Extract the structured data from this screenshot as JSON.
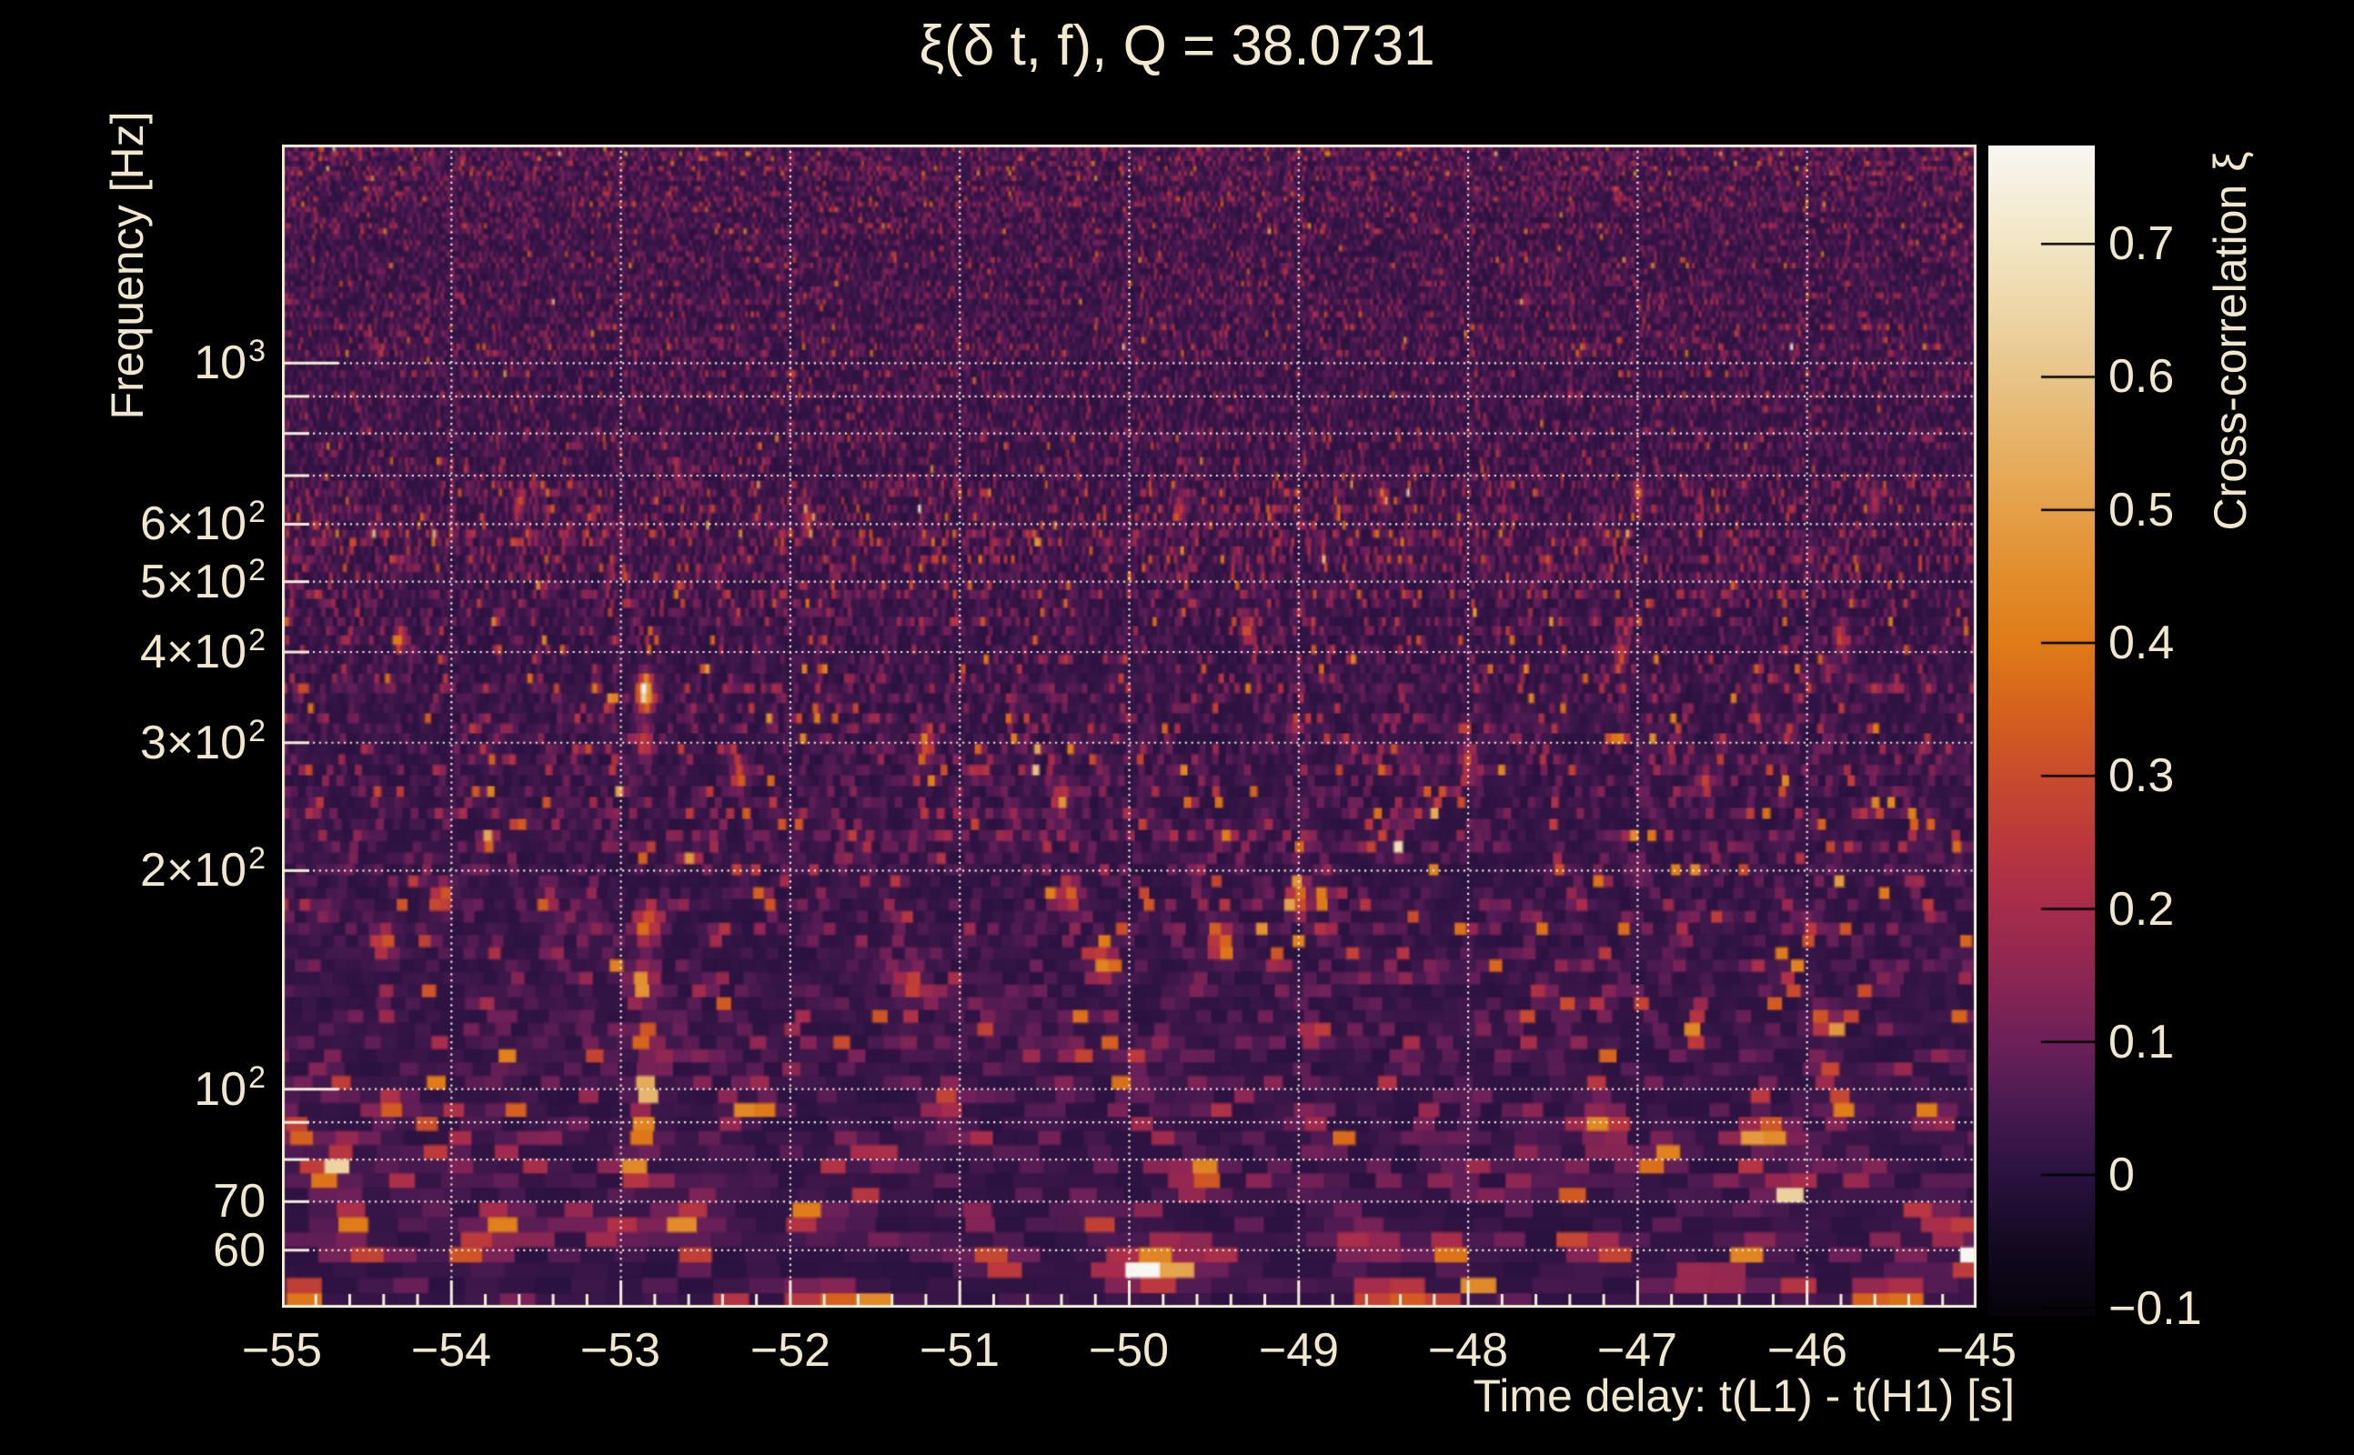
{
  "chart_data": {
    "type": "heatmap",
    "title": "ξ(δ t, f), Q = 38.0731",
    "q_value": 38.0731,
    "xlabel": "Time delay: t(L1) - t(H1) [s]",
    "ylabel": "Frequency [Hz]",
    "colorbar_label": "Cross-correlation ξ",
    "x_range_s": [
      -55,
      -45
    ],
    "y_range_hz": [
      50,
      2000
    ],
    "y_scale": "log",
    "z_range": [
      -0.106,
      0.774
    ],
    "grid": "dotted, every 1 s vertical; 60-1000 Hz decades horizontal",
    "x_ticks": [
      {
        "t": -55,
        "label": "−55"
      },
      {
        "t": -54,
        "label": "−54"
      },
      {
        "t": -53,
        "label": "−53"
      },
      {
        "t": -52,
        "label": "−52"
      },
      {
        "t": -51,
        "label": "−51"
      },
      {
        "t": -50,
        "label": "−50"
      },
      {
        "t": -49,
        "label": "−49"
      },
      {
        "t": -48,
        "label": "−48"
      },
      {
        "t": -47,
        "label": "−47"
      },
      {
        "t": -46,
        "label": "−46"
      },
      {
        "t": -45,
        "label": "−45"
      }
    ],
    "x_minor_tick_step_s": 0.2,
    "y_ticks": [
      {
        "f": 1000,
        "base": "10",
        "sup": "3"
      },
      {
        "f": 600,
        "base": "6×10",
        "sup": "2"
      },
      {
        "f": 500,
        "base": "5×10",
        "sup": "2"
      },
      {
        "f": 400,
        "base": "4×10",
        "sup": "2"
      },
      {
        "f": 300,
        "base": "3×10",
        "sup": "2"
      },
      {
        "f": 200,
        "base": "2×10",
        "sup": "2"
      },
      {
        "f": 100,
        "base": "10",
        "sup": "2"
      },
      {
        "f": 70,
        "base": "70"
      },
      {
        "f": 60,
        "base": "60"
      }
    ],
    "grid_frequencies": [
      60,
      70,
      80,
      90,
      100,
      200,
      300,
      400,
      500,
      600,
      700,
      800,
      900,
      1000
    ],
    "y_major_tick_frequencies": [
      100,
      1000
    ],
    "y_minor_tick_frequencies": [
      60,
      70,
      80,
      90,
      200,
      300,
      400,
      500,
      600,
      700,
      800,
      900,
      2000
    ],
    "colorbar_ticks": [
      {
        "v": 0.7,
        "label": "0.7"
      },
      {
        "v": 0.6,
        "label": "0.6"
      },
      {
        "v": 0.5,
        "label": "0.5"
      },
      {
        "v": 0.4,
        "label": "0.4"
      },
      {
        "v": 0.3,
        "label": "0.3"
      },
      {
        "v": 0.2,
        "label": "0.2"
      },
      {
        "v": 0.1,
        "label": "0.1"
      },
      {
        "v": 0.0,
        "label": "0"
      },
      {
        "v": -0.1,
        "label": "−0.1"
      }
    ],
    "colormap": [
      {
        "v": -0.106,
        "c": "#060309"
      },
      {
        "v": -0.05,
        "c": "#140a22"
      },
      {
        "v": 0.0,
        "c": "#2a1240"
      },
      {
        "v": 0.05,
        "c": "#481a50"
      },
      {
        "v": 0.1,
        "c": "#6d2059"
      },
      {
        "v": 0.15,
        "c": "#8c2653"
      },
      {
        "v": 0.2,
        "c": "#a62c4c"
      },
      {
        "v": 0.25,
        "c": "#ba383e"
      },
      {
        "v": 0.3,
        "c": "#c94b2c"
      },
      {
        "v": 0.35,
        "c": "#d6621e"
      },
      {
        "v": 0.4,
        "c": "#df7c18"
      },
      {
        "v": 0.45,
        "c": "#e28d2c"
      },
      {
        "v": 0.5,
        "c": "#e5a048"
      },
      {
        "v": 0.55,
        "c": "#e7b266"
      },
      {
        "v": 0.6,
        "c": "#e9c489"
      },
      {
        "v": 0.65,
        "c": "#eed6a7"
      },
      {
        "v": 0.7,
        "c": "#f2e6c4"
      },
      {
        "v": 0.774,
        "c": "#f8f7f2"
      }
    ],
    "noise_bands": [
      {
        "f_lo": 50,
        "f_hi": 65,
        "v": 0.035,
        "sp": 0.05,
        "sa": 0.3
      },
      {
        "f_lo": 65,
        "f_hi": 100,
        "v": 0.038,
        "sp": 0.04,
        "sa": 0.26
      },
      {
        "f_lo": 100,
        "f_hi": 200,
        "v": 0.04,
        "sp": 0.03,
        "sa": 0.26
      },
      {
        "f_lo": 200,
        "f_hi": 450,
        "v": 0.048,
        "sp": 0.025,
        "sa": 0.27
      },
      {
        "f_lo": 450,
        "f_hi": 750,
        "v": 0.058,
        "sp": 0.018,
        "sa": 0.22
      },
      {
        "f_lo": 750,
        "f_hi": 1000,
        "v": 0.046,
        "sp": 0.006,
        "sa": 0.14
      },
      {
        "f_lo": 1000,
        "f_hi": 1500,
        "v": 0.052,
        "sp": 0.004,
        "sa": 0.1
      },
      {
        "f_lo": 1500,
        "f_hi": 2001,
        "v": 0.06,
        "sp": 0.004,
        "sa": 0.1
      }
    ],
    "hotspots": [
      [
        -52.86,
        352,
        0.7,
        0.03,
        0.016
      ],
      [
        -52.86,
        300,
        0.28,
        0.03,
        0.014
      ],
      [
        -52.85,
        168,
        0.4,
        0.045,
        0.016
      ],
      [
        -52.87,
        140,
        0.5,
        0.045,
        0.016
      ],
      [
        -52.86,
        118,
        0.44,
        0.04,
        0.015
      ],
      [
        -52.85,
        100,
        0.6,
        0.045,
        0.015
      ],
      [
        -52.88,
        88,
        0.46,
        0.05,
        0.014
      ],
      [
        -52.92,
        78,
        0.38,
        0.055,
        0.014
      ],
      [
        -52.62,
        66,
        0.48,
        0.085,
        0.014
      ],
      [
        -53.05,
        64,
        0.33,
        0.085,
        0.013
      ],
      [
        -53.7,
        66,
        0.42,
        0.085,
        0.014
      ],
      [
        -53.85,
        60,
        0.4,
        0.08,
        0.013
      ],
      [
        -54.73,
        77,
        0.42,
        0.075,
        0.014
      ],
      [
        -54.87,
        52,
        0.42,
        0.08,
        0.012
      ],
      [
        -54.95,
        88,
        0.4,
        0.05,
        0.014
      ],
      [
        -54.6,
        66,
        0.36,
        0.08,
        0.013
      ],
      [
        -54.35,
        95,
        0.34,
        0.06,
        0.014
      ],
      [
        -54.4,
        160,
        0.36,
        0.045,
        0.015
      ],
      [
        -54.05,
        185,
        0.36,
        0.04,
        0.015
      ],
      [
        -51.82,
        52,
        0.64,
        0.08,
        0.012
      ],
      [
        -51.88,
        67,
        0.46,
        0.07,
        0.013
      ],
      [
        -51.3,
        140,
        0.35,
        0.045,
        0.015
      ],
      [
        -51.1,
        95,
        0.35,
        0.05,
        0.014
      ],
      [
        -50.75,
        58,
        0.36,
        0.09,
        0.012
      ],
      [
        -50.35,
        185,
        0.35,
        0.04,
        0.015
      ],
      [
        -50.15,
        150,
        0.4,
        0.045,
        0.015
      ],
      [
        -49.87,
        57,
        0.72,
        0.16,
        0.015
      ],
      [
        -49.6,
        76,
        0.44,
        0.07,
        0.014
      ],
      [
        -49.45,
        160,
        0.38,
        0.045,
        0.015
      ],
      [
        -49.0,
        185,
        0.38,
        0.04,
        0.015
      ],
      [
        -48.45,
        52,
        0.52,
        0.11,
        0.013
      ],
      [
        -48.6,
        62,
        0.38,
        0.07,
        0.013
      ],
      [
        -48.1,
        60,
        0.4,
        0.08,
        0.013
      ],
      [
        -47.2,
        90,
        0.48,
        0.07,
        0.014
      ],
      [
        -47.2,
        60,
        0.36,
        0.09,
        0.013
      ],
      [
        -46.85,
        82,
        0.4,
        0.06,
        0.013
      ],
      [
        -46.6,
        55,
        0.34,
        0.09,
        0.012
      ],
      [
        -46.35,
        60,
        0.4,
        0.07,
        0.013
      ],
      [
        -46.2,
        87,
        0.48,
        0.08,
        0.014
      ],
      [
        -46.1,
        73,
        0.4,
        0.06,
        0.013
      ],
      [
        -45.9,
        107,
        0.4,
        0.04,
        0.014
      ],
      [
        -45.8,
        95,
        0.42,
        0.05,
        0.014
      ],
      [
        -45.9,
        125,
        0.36,
        0.04,
        0.015
      ],
      [
        -45.5,
        52,
        0.52,
        0.12,
        0.013
      ],
      [
        -45.15,
        65,
        0.46,
        0.07,
        0.013
      ],
      [
        -45.05,
        58,
        0.38,
        0.06,
        0.012
      ],
      [
        -52.3,
        270,
        0.28,
        0.03,
        0.014
      ],
      [
        -51.2,
        300,
        0.28,
        0.03,
        0.014
      ],
      [
        -50.4,
        255,
        0.28,
        0.03,
        0.014
      ],
      [
        -49.3,
        430,
        0.28,
        0.025,
        0.014
      ],
      [
        -48.0,
        285,
        0.26,
        0.03,
        0.014
      ],
      [
        -47.1,
        400,
        0.26,
        0.025,
        0.014
      ],
      [
        -46.6,
        265,
        0.26,
        0.03,
        0.014
      ],
      [
        -45.8,
        420,
        0.26,
        0.025,
        0.014
      ],
      [
        -54.3,
        420,
        0.28,
        0.025,
        0.014
      ],
      [
        -53.6,
        640,
        0.24,
        0.02,
        0.013
      ],
      [
        -51.9,
        615,
        0.24,
        0.02,
        0.013
      ],
      [
        -49.7,
        630,
        0.24,
        0.02,
        0.013
      ],
      [
        -48.5,
        655,
        0.24,
        0.02,
        0.013
      ],
      [
        -47.0,
        660,
        0.22,
        0.02,
        0.013
      ],
      [
        -45.6,
        645,
        0.22,
        0.02,
        0.013
      ]
    ]
  },
  "colors": {
    "background": "#000000",
    "text": "#f0e7cc",
    "frame": "#f3edda"
  }
}
